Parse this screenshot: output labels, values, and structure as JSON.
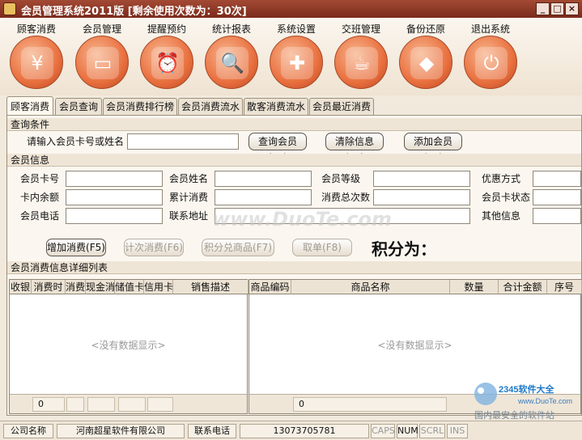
{
  "window": {
    "title": "会员管理系统2011版 [剩余使用次数为：30次]"
  },
  "toolbar": [
    {
      "label": "顾客消费",
      "icon": "coins-icon",
      "glyph": "¥"
    },
    {
      "label": "会员管理",
      "icon": "member-card-icon",
      "glyph": "▭"
    },
    {
      "label": "提醒预约",
      "icon": "alarm-clock-icon",
      "glyph": "⏰"
    },
    {
      "label": "统计报表",
      "icon": "report-magnifier-icon",
      "glyph": "🔍"
    },
    {
      "label": "系统设置",
      "icon": "signpost-icon",
      "glyph": "✚"
    },
    {
      "label": "交班管理",
      "icon": "tea-cup-icon",
      "glyph": "☕"
    },
    {
      "label": "备份还原",
      "icon": "disk-icon",
      "glyph": "◆"
    },
    {
      "label": "退出系统",
      "icon": "power-icon",
      "glyph": "⏻"
    }
  ],
  "tabs": [
    "顾客消费",
    "会员查询",
    "会员消费排行榜",
    "会员消费流水",
    "散客消费流水",
    "会员最近消费"
  ],
  "query": {
    "section_title": "查询条件",
    "prompt": "请输入会员卡号或姓名",
    "input_value": "",
    "search_button": "查询会员(F2)",
    "clear_button": "清除信息(F3)",
    "add_button": "添加会员(F4)"
  },
  "member": {
    "section_title": "会员信息",
    "card_no": "会员卡号",
    "name": "会员姓名",
    "level": "会员等级",
    "discount": "优惠方式",
    "balance": "卡内余额",
    "total_spend": "累计消费",
    "total_count": "消费总次数",
    "card_status": "会员卡状态",
    "phone": "会员电话",
    "address": "联系地址",
    "other": "其他信息"
  },
  "actions": {
    "add_consume": "增加消费(F5)",
    "count_consume": "计次消费(F6)",
    "points_exchange": "积分兑商品(F7)",
    "cancel": "取单(F8)",
    "points_label": "积分为："
  },
  "details": {
    "section_title": "会员消费信息详细列表",
    "left_columns": [
      "收银",
      "消费时",
      "消费",
      "现金消",
      "储值卡",
      "信用卡",
      "销售描述"
    ],
    "right_columns": [
      "商品编码",
      "商品名称",
      "数量",
      "合计金额",
      "序号"
    ],
    "empty_text": "<没有数据显示>",
    "left_footer": "0",
    "right_footer": "0"
  },
  "status": {
    "company_label": "公司名称",
    "company": "河南超星软件有限公司",
    "phone_label": "联系电话",
    "phone": "13073705781",
    "caps": "CAPS",
    "num": "NUM",
    "scrl": "SCRL",
    "ins": "INS"
  },
  "watermark": "www.DuoTe.com",
  "logo": {
    "brand": "2345软件大全",
    "url": "www.DuoTe.com",
    "tagline": "国内最安全的软件站"
  },
  "colors": {
    "accent": "#e9703f",
    "titlebar": "#8c3626"
  }
}
